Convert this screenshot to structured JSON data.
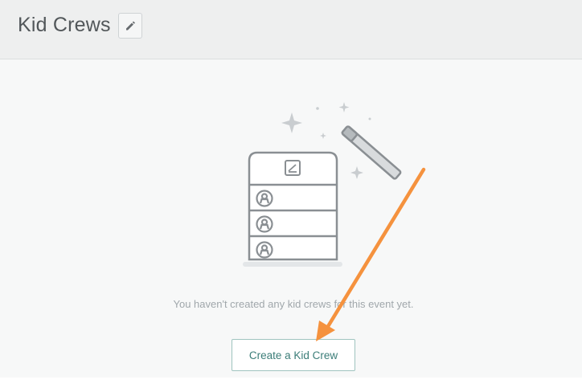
{
  "header": {
    "title": "Kid Crews",
    "edit_icon": "pencil-icon"
  },
  "empty_state": {
    "message": "You haven't created any kid crews for this event yet.",
    "illustration_icons": [
      "sparkle-icon",
      "magic-wand-icon",
      "roster-list-icon",
      "person-badge-icon"
    ]
  },
  "actions": {
    "create_label": "Create a Kid Crew"
  },
  "annotation": {
    "arrow_color": "#f5923e"
  },
  "colors": {
    "accent": "#3b7d78",
    "accent_border": "#9fc4bf",
    "header_bg": "#eeefef",
    "illustration": "#8a8f93"
  }
}
